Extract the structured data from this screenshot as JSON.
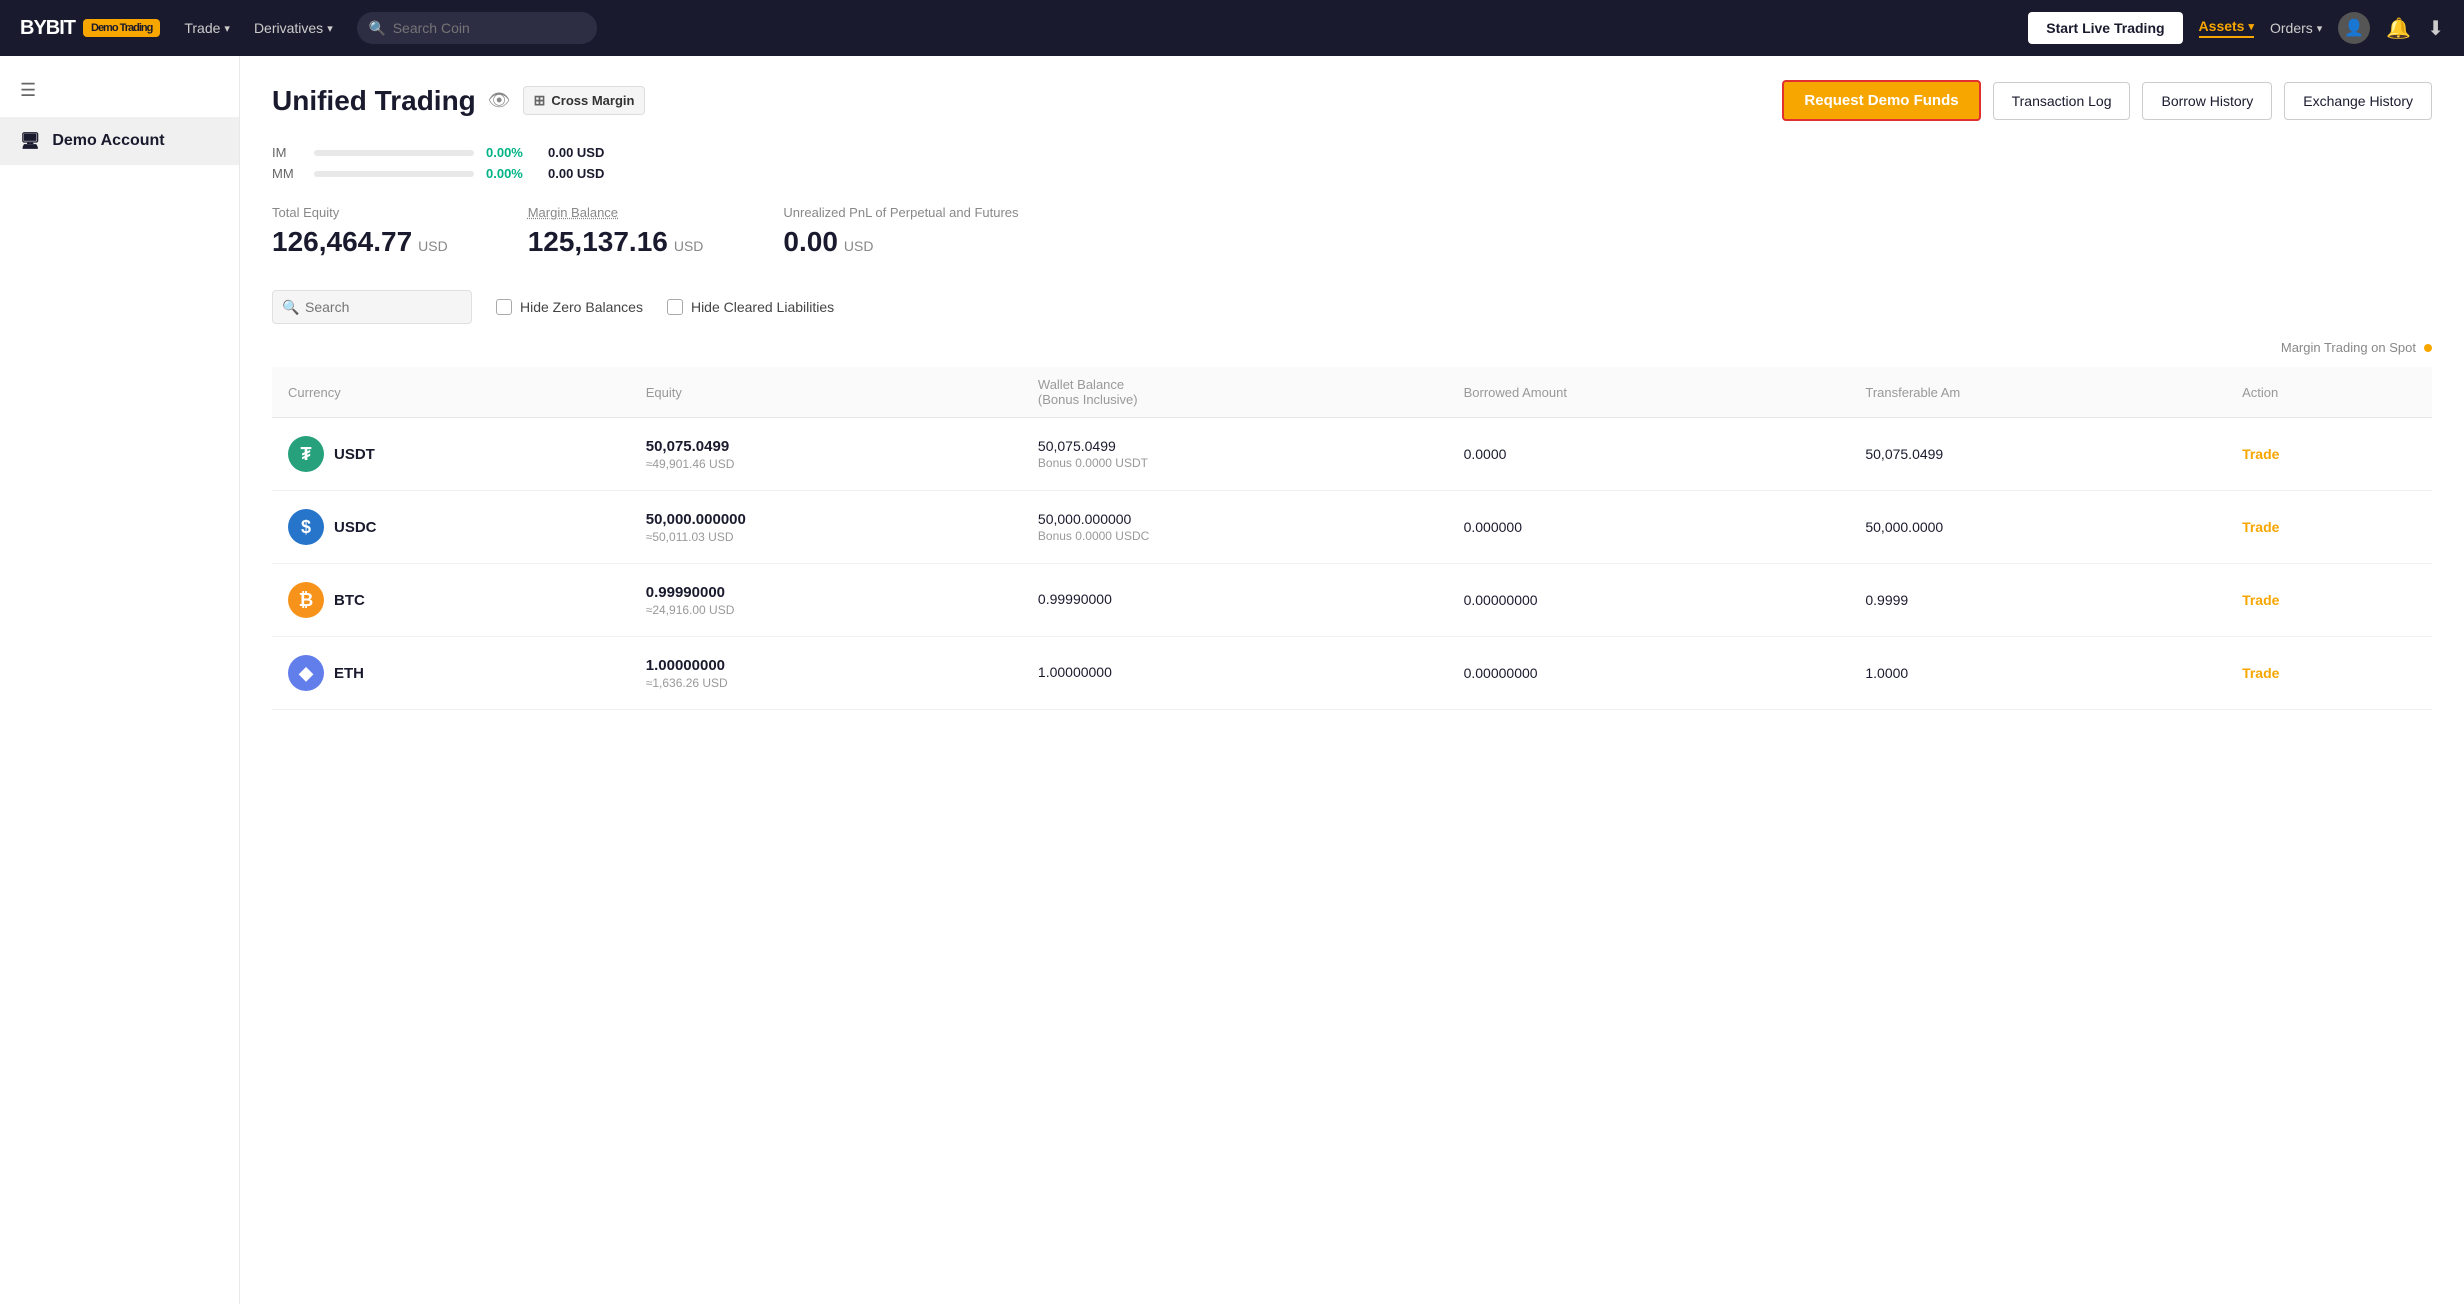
{
  "brand": {
    "logo": "BYBIT",
    "demo_badge": "Demo Trading"
  },
  "navbar": {
    "trade_label": "Trade",
    "derivatives_label": "Derivatives",
    "search_placeholder": "Search Coin",
    "start_live_trading": "Start Live Trading",
    "assets_label": "Assets",
    "orders_label": "Orders"
  },
  "sidebar": {
    "menu_icon": "☰",
    "demo_account_label": "Demo Account"
  },
  "header": {
    "title": "Unified Trading",
    "cross_margin_label": "Cross Margin",
    "request_demo_btn": "Request Demo Funds",
    "transaction_log_btn": "Transaction Log",
    "borrow_history_btn": "Borrow History",
    "exchange_history_btn": "Exchange History",
    "margin_trading_label": "Margin Trading on Spot"
  },
  "im_mm": {
    "im_label": "IM",
    "mm_label": "MM",
    "im_pct": "0.00%",
    "mm_pct": "0.00%",
    "im_val": "0.00 USD",
    "mm_val": "0.00 USD"
  },
  "metrics": {
    "total_equity_label": "Total Equity",
    "total_equity_value": "126,464.77",
    "total_equity_unit": "USD",
    "margin_balance_label": "Margin Balance",
    "margin_balance_value": "125,137.16",
    "margin_balance_unit": "USD",
    "unrealized_pnl_label": "Unrealized PnL of Perpetual and Futures",
    "unrealized_pnl_value": "0.00",
    "unrealized_pnl_unit": "USD"
  },
  "table_filters": {
    "search_placeholder": "Search",
    "hide_zero_balances": "Hide Zero Balances",
    "hide_cleared_liabilities": "Hide Cleared Liabilities"
  },
  "table_headers": {
    "currency": "Currency",
    "equity": "Equity",
    "wallet_balance": "Wallet Balance",
    "wallet_balance_sub": "(Bonus Inclusive)",
    "borrowed_amount": "Borrowed Amount",
    "transferable_amount": "Transferable Am",
    "action": "Action"
  },
  "table_rows": [
    {
      "coin": "USDT",
      "coin_class": "coin-usdt",
      "coin_symbol_text": "₮",
      "equity_primary": "50,075.0499",
      "equity_secondary": "≈49,901.46 USD",
      "wallet_primary": "50,075.0499",
      "wallet_secondary": "Bonus 0.0000 USDT",
      "borrowed_amount": "0.0000",
      "transferable_amount": "50,075.0499",
      "action": "Trade"
    },
    {
      "coin": "USDC",
      "coin_class": "coin-usdc",
      "coin_symbol_text": "$",
      "equity_primary": "50,000.000000",
      "equity_secondary": "≈50,011.03 USD",
      "wallet_primary": "50,000.000000",
      "wallet_secondary": "Bonus 0.0000 USDC",
      "borrowed_amount": "0.000000",
      "transferable_amount": "50,000.0000",
      "action": "Trade"
    },
    {
      "coin": "BTC",
      "coin_class": "coin-btc",
      "coin_symbol_text": "₿",
      "equity_primary": "0.99990000",
      "equity_secondary": "≈24,916.00 USD",
      "wallet_primary": "0.99990000",
      "wallet_secondary": "",
      "borrowed_amount": "0.00000000",
      "transferable_amount": "0.9999",
      "action": "Trade"
    },
    {
      "coin": "ETH",
      "coin_class": "coin-eth",
      "coin_symbol_text": "◆",
      "equity_primary": "1.00000000",
      "equity_secondary": "≈1,636.26 USD",
      "wallet_primary": "1.00000000",
      "wallet_secondary": "",
      "borrowed_amount": "0.00000000",
      "transferable_amount": "1.0000",
      "action": "Trade"
    }
  ],
  "colors": {
    "accent": "#f7a600",
    "green": "#00b386",
    "dark": "#1a1a2e",
    "border_red": "#e03030"
  }
}
